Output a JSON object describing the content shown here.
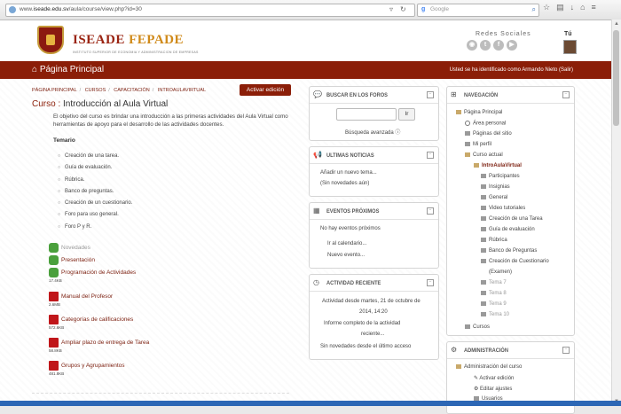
{
  "browser": {
    "url_prefix": "www.",
    "url_host": "iseade.edu.sv",
    "url_path": "/aula/course/view.php?id=30",
    "search_engine": "g",
    "search_placeholder": "Google"
  },
  "header": {
    "brand_left": "ISEADE",
    "brand_right": "FEPADE",
    "brand_sub": "INSTITUTO SUPERIOR DE ECONOMIA Y ADMINISTRACION DE EMPRESAS",
    "social_title": "Redes Sociales",
    "social_icons": [
      "rss-icon",
      "twitter-icon",
      "facebook-icon",
      "youtube-icon"
    ],
    "user_label": "Tú"
  },
  "navbar": {
    "home_label": "Página Principal",
    "identity_text": "Usted se ha identificado como Armando Nieto (Salir)"
  },
  "breadcrumb": [
    "PÁGINA PRINCIPAL",
    "CURSOS",
    "CAPACITACIÓN",
    "INTROAULAVIRTUAL"
  ],
  "edit_button": "Activar edición",
  "course": {
    "title_prefix": "Curso : ",
    "title": "Introducción al Aula Virtual",
    "description": "El objetivo del curso es brindar una introducción a las primeras actividades del Aula Virtual como herramientas de apoyo para el desarrollo de las actividades docentes.",
    "temario_label": "Temario",
    "topics": [
      "Creación de una tarea.",
      "Guía de evaluación.",
      "Rúbrica.",
      "Banco de preguntas.",
      "Creación de un cuestionario.",
      "Foro para uso general.",
      "Foro P y R."
    ],
    "resources": [
      {
        "label": "Novedades",
        "size": ""
      },
      {
        "label": "Presentación",
        "size": ""
      },
      {
        "label": "Programación de Actividades",
        "size": "17.4KB"
      },
      {
        "label": "Manual del Profesor",
        "size": "2.6MB"
      },
      {
        "label": "Categorías de calificaciones",
        "size": "572.6KB"
      },
      {
        "label": "Ampliar plazo de entrega de Tarea",
        "size": "58.8KB"
      },
      {
        "label": "Grupos y Agrupamientos",
        "size": "481.8KB"
      }
    ]
  },
  "blocks": {
    "search": {
      "title": "BUSCAR EN LOS FOROS",
      "go": "Ir",
      "advanced": "Búsqueda avanzada"
    },
    "news": {
      "title": "ÚLTIMAS NOTICIAS",
      "add": "Añadir un nuevo tema...",
      "none": "(Sin novedades aún)"
    },
    "events": {
      "title": "EVENTOS PRÓXIMOS",
      "none": "No hay eventos próximos",
      "calendar": "Ir al calendario...",
      "new_event": "Nuevo evento..."
    },
    "recent": {
      "title": "ACTIVIDAD RECIENTE",
      "since_line1": "Actividad desde martes, 21 de octubre de",
      "since_line2": "2014, 14:20",
      "report_line1": "Informe completo de la actividad",
      "report_line2": "reciente...",
      "none": "Sin novedades desde el último acceso"
    },
    "navigation": {
      "title": "NAVEGACIÓN",
      "items": [
        {
          "label": "Página Principal"
        },
        {
          "label": "Área personal"
        },
        {
          "label": "Páginas del sitio"
        },
        {
          "label": "Mi perfil"
        },
        {
          "label": "Curso actual"
        },
        {
          "label": "IntroAulaVirtual"
        },
        {
          "label": "Participantes"
        },
        {
          "label": "Insignias"
        },
        {
          "label": "General"
        },
        {
          "label": "Video tutoriales"
        },
        {
          "label": "Creación de una Tarea"
        },
        {
          "label": "Guía de evaluación"
        },
        {
          "label": "Rúbrica"
        },
        {
          "label": "Banco de Preguntas"
        },
        {
          "label": "Creación de Cuestionario"
        },
        {
          "label": "(Examen)"
        },
        {
          "label": "Tema 7"
        },
        {
          "label": "Tema 8"
        },
        {
          "label": "Tema 9"
        },
        {
          "label": "Tema 10"
        },
        {
          "label": "Cursos"
        }
      ]
    },
    "admin": {
      "title": "ADMINISTRACIÓN",
      "items": [
        {
          "label": "Administración del curso"
        },
        {
          "label": "Activar edición"
        },
        {
          "label": "Editar ajustes"
        },
        {
          "label": "Usuarios"
        }
      ]
    }
  },
  "colors": {
    "brand": "#8b1e08",
    "link": "#7b1e0e",
    "gold": "#d08a1a"
  }
}
